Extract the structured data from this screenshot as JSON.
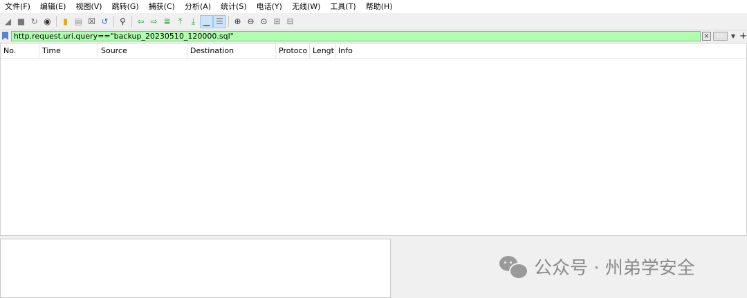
{
  "menu": [
    "文件(F)",
    "编辑(E)",
    "视图(V)",
    "跳转(G)",
    "捕获(C)",
    "分析(A)",
    "统计(S)",
    "电话(Y)",
    "无线(W)",
    "工具(T)",
    "帮助(H)"
  ],
  "toolbar": {
    "buttons": [
      {
        "name": "start-capture-icon",
        "glyph": "◢",
        "color": "#777777"
      },
      {
        "name": "stop-capture-icon",
        "glyph": "■",
        "color": "#777777"
      },
      {
        "name": "restart-capture-icon",
        "glyph": "↻",
        "color": "#777777"
      },
      {
        "name": "capture-options-icon",
        "glyph": "◉",
        "color": "#333333"
      },
      {
        "name": "open-file-icon",
        "glyph": "▮",
        "color": "#e0a800"
      },
      {
        "name": "save-file-icon",
        "glyph": "▤",
        "color": "#999999"
      },
      {
        "name": "close-file-icon",
        "glyph": "☒",
        "color": "#444444"
      },
      {
        "name": "reload-icon",
        "glyph": "↺",
        "color": "#2b6fb3"
      },
      {
        "name": "find-packet-icon",
        "glyph": "⚲",
        "color": "#333333"
      },
      {
        "name": "go-back-icon",
        "glyph": "⇦",
        "color": "#3aa33a"
      },
      {
        "name": "go-forward-icon",
        "glyph": "⇨",
        "color": "#3aa33a"
      },
      {
        "name": "go-to-packet-icon",
        "glyph": "≣",
        "color": "#3aa33a"
      },
      {
        "name": "first-packet-icon",
        "glyph": "⤒",
        "color": "#3aa33a"
      },
      {
        "name": "last-packet-icon",
        "glyph": "⤓",
        "color": "#3aa33a"
      },
      {
        "name": "auto-scroll-icon",
        "glyph": "▁",
        "color": "#2b6fb3",
        "active": true
      },
      {
        "name": "colorize-icon",
        "glyph": "☰",
        "color": "#777777",
        "active": true
      },
      {
        "name": "zoom-in-icon",
        "glyph": "⊕",
        "color": "#333333"
      },
      {
        "name": "zoom-out-icon",
        "glyph": "⊖",
        "color": "#333333"
      },
      {
        "name": "normal-size-icon",
        "glyph": "⊙",
        "color": "#333333"
      },
      {
        "name": "resize-columns-icon",
        "glyph": "⊞",
        "color": "#777777"
      },
      {
        "name": "layout-icon",
        "glyph": "⊟",
        "color": "#777777"
      }
    ]
  },
  "filter": {
    "value": "http.request.uri.query==\"backup_20230510_120000.sql\"",
    "background": "#afffaf"
  },
  "packet_list": {
    "columns": [
      "No.",
      "Time",
      "Source",
      "Destination",
      "Protoco",
      "Lengt",
      "Info"
    ]
  },
  "watermark": {
    "text": "公众号 · 州弟学安全"
  }
}
